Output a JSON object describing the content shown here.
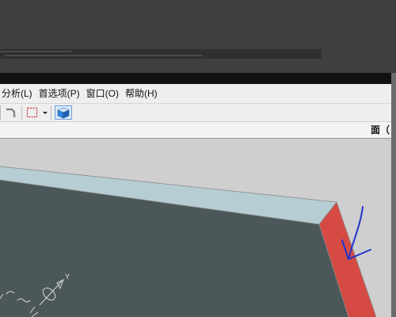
{
  "menu": {
    "items": [
      {
        "id": "analysis",
        "label": "分析(L)"
      },
      {
        "id": "preferences",
        "label": "首选项(P)"
      },
      {
        "id": "window",
        "label": "窗口(O)"
      },
      {
        "id": "help",
        "label": "帮助(H)"
      }
    ]
  },
  "panel": {
    "title": "面（"
  },
  "axis": {
    "y_label": "Y"
  },
  "colors": {
    "viewport_bg": "#cfcfcf",
    "solid_body": "#4b5759",
    "top_face": "#b6cdd3",
    "selected_face": "#d54b43",
    "annotation_stroke": "#2233cc"
  },
  "icons": [
    "command-icon",
    "selection-box-icon",
    "dropdown-arrow-icon",
    "shaded-cube-icon"
  ]
}
